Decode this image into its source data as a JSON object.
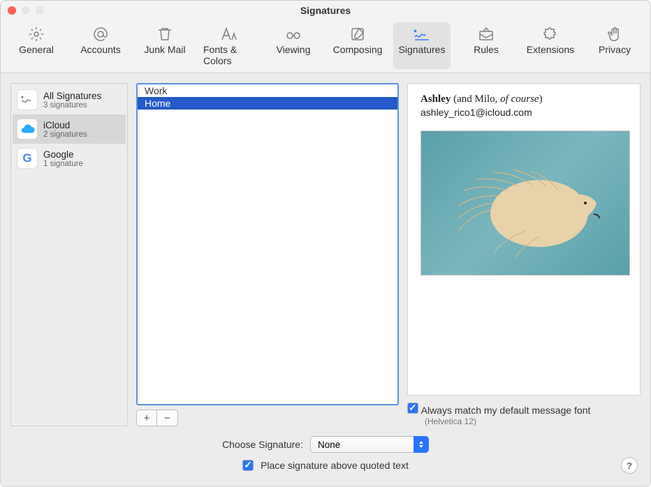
{
  "window": {
    "title": "Signatures"
  },
  "toolbar": {
    "items": [
      {
        "label": "General",
        "name": "tab-general"
      },
      {
        "label": "Accounts",
        "name": "tab-accounts"
      },
      {
        "label": "Junk Mail",
        "name": "tab-junk-mail"
      },
      {
        "label": "Fonts & Colors",
        "name": "tab-fonts-colors"
      },
      {
        "label": "Viewing",
        "name": "tab-viewing"
      },
      {
        "label": "Composing",
        "name": "tab-composing"
      },
      {
        "label": "Signatures",
        "name": "tab-signatures"
      },
      {
        "label": "Rules",
        "name": "tab-rules"
      },
      {
        "label": "Extensions",
        "name": "tab-extensions"
      },
      {
        "label": "Privacy",
        "name": "tab-privacy"
      }
    ],
    "selected_index": 6
  },
  "accounts": [
    {
      "title": "All Signatures",
      "subtitle": "3 signatures"
    },
    {
      "title": "iCloud",
      "subtitle": "2 signatures"
    },
    {
      "title": "Google",
      "subtitle": "1 signature"
    }
  ],
  "selected_account_index": 1,
  "signatures": [
    "Work",
    "Home"
  ],
  "selected_signature_index": 1,
  "preview": {
    "name_bold": "Ashley",
    "name_rest": " (and Milo, ",
    "name_italic": "of  course",
    "name_close": ")",
    "email": "ashley_rico1@icloud.com"
  },
  "options": {
    "match_font_label": "Always match my default message font",
    "match_font_sub": "(Helvetica 12)",
    "match_font_checked": true,
    "choose_label": "Choose Signature:",
    "choose_value": "None",
    "place_above_label": "Place signature above quoted text",
    "place_above_checked": true
  },
  "buttons": {
    "add": "+",
    "remove": "−",
    "help": "?"
  }
}
